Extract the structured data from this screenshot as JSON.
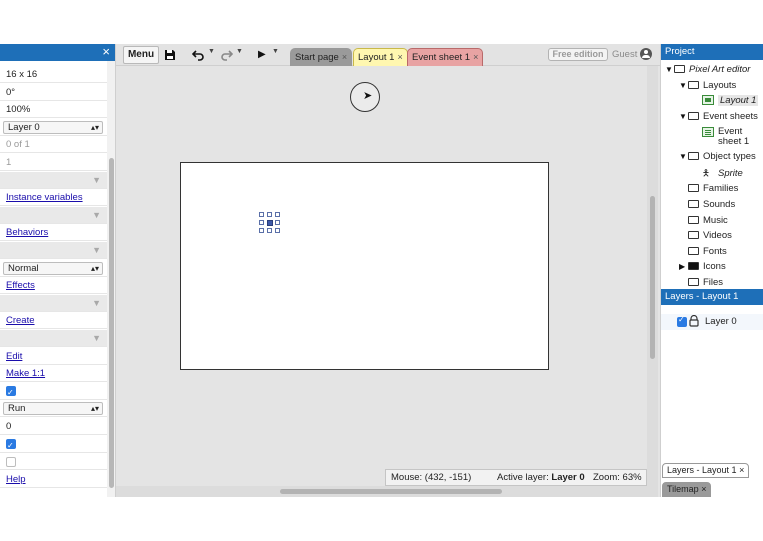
{
  "left_panel": {
    "close_glyph": "×",
    "rows": [
      {
        "type": "text",
        "text": "16 x 16"
      },
      {
        "type": "text",
        "text": "0°"
      },
      {
        "type": "text",
        "text": "100%"
      },
      {
        "type": "select",
        "text": "Layer 0"
      },
      {
        "type": "dim",
        "text": "0 of 1"
      },
      {
        "type": "dim",
        "text": "1"
      },
      {
        "type": "header",
        "text": ""
      },
      {
        "type": "link",
        "text": "Instance variables"
      },
      {
        "type": "header",
        "text": ""
      },
      {
        "type": "link",
        "text": "Behaviors"
      },
      {
        "type": "header",
        "text": ""
      },
      {
        "type": "select",
        "text": "Normal"
      },
      {
        "type": "link",
        "text": "Effects"
      },
      {
        "type": "header",
        "text": ""
      },
      {
        "type": "link",
        "text": "Create"
      },
      {
        "type": "header",
        "text": ""
      },
      {
        "type": "link",
        "text": "Edit"
      },
      {
        "type": "link",
        "text": "Make 1:1"
      },
      {
        "type": "checkbox_on",
        "text": ""
      },
      {
        "type": "select",
        "text": "Run"
      },
      {
        "type": "text",
        "text": "0"
      },
      {
        "type": "checkbox_on",
        "text": ""
      },
      {
        "type": "checkbox_off",
        "text": ""
      },
      {
        "type": "link",
        "text": "Help"
      }
    ]
  },
  "toolbar": {
    "menu_label": "Menu",
    "save_icon": "save-icon",
    "undo_icon": "undo-icon",
    "redo_icon": "redo-icon",
    "play_icon": "play-icon",
    "free_edition_label": "Free edition",
    "guest_label": "Guest"
  },
  "tabs": [
    {
      "label": "Start page",
      "color": "#9a9a9a",
      "active": false
    },
    {
      "label": "Layout 1",
      "color": "#fff7b0",
      "active": true
    },
    {
      "label": "Event sheet 1",
      "color": "#e8a3a3",
      "active": false
    }
  ],
  "status_bar": {
    "mouse_label": "Mouse: (432, -151)",
    "active_layer_prefix": "Active layer: ",
    "active_layer_value": "Layer 0",
    "zoom_label": "Zoom: 63%"
  },
  "project_panel": {
    "title": "Project",
    "tree": [
      {
        "label": "Pixel Art editor",
        "indent": 0,
        "twisty": "▼",
        "icon": "folder",
        "italic": true
      },
      {
        "label": "Layouts",
        "indent": 1,
        "twisty": "▼",
        "icon": "folder",
        "italic": false
      },
      {
        "label": "Layout 1",
        "indent": 2,
        "twisty": "",
        "icon": "layout",
        "italic": true
      },
      {
        "label": "Event sheets",
        "indent": 1,
        "twisty": "▼",
        "icon": "folder",
        "italic": false
      },
      {
        "label": "Event sheet 1",
        "indent": 2,
        "twisty": "",
        "icon": "eventsheet",
        "italic": false
      },
      {
        "label": "Object types",
        "indent": 1,
        "twisty": "▼",
        "icon": "folder",
        "italic": false
      },
      {
        "label": "Sprite",
        "indent": 2,
        "twisty": "",
        "icon": "sprite",
        "italic": true
      },
      {
        "label": "Families",
        "indent": 1,
        "twisty": "",
        "icon": "folder",
        "italic": false
      },
      {
        "label": "Sounds",
        "indent": 1,
        "twisty": "",
        "icon": "folder",
        "italic": false
      },
      {
        "label": "Music",
        "indent": 1,
        "twisty": "",
        "icon": "folder",
        "italic": false
      },
      {
        "label": "Videos",
        "indent": 1,
        "twisty": "",
        "icon": "folder",
        "italic": false
      },
      {
        "label": "Fonts",
        "indent": 1,
        "twisty": "",
        "icon": "folder",
        "italic": false
      },
      {
        "label": "Icons",
        "indent": 1,
        "twisty": "▶",
        "icon": "folder-filled",
        "italic": false
      },
      {
        "label": "Files",
        "indent": 1,
        "twisty": "",
        "icon": "folder",
        "italic": false
      }
    ]
  },
  "layers_panel": {
    "title": "Layers - Layout 1",
    "layer_label": "Layer 0",
    "bottom_tabs": [
      {
        "label": "Layers - Layout 1",
        "closable": true
      },
      {
        "label": "Tilemap",
        "closable": true
      }
    ],
    "close_glyph": "×"
  }
}
